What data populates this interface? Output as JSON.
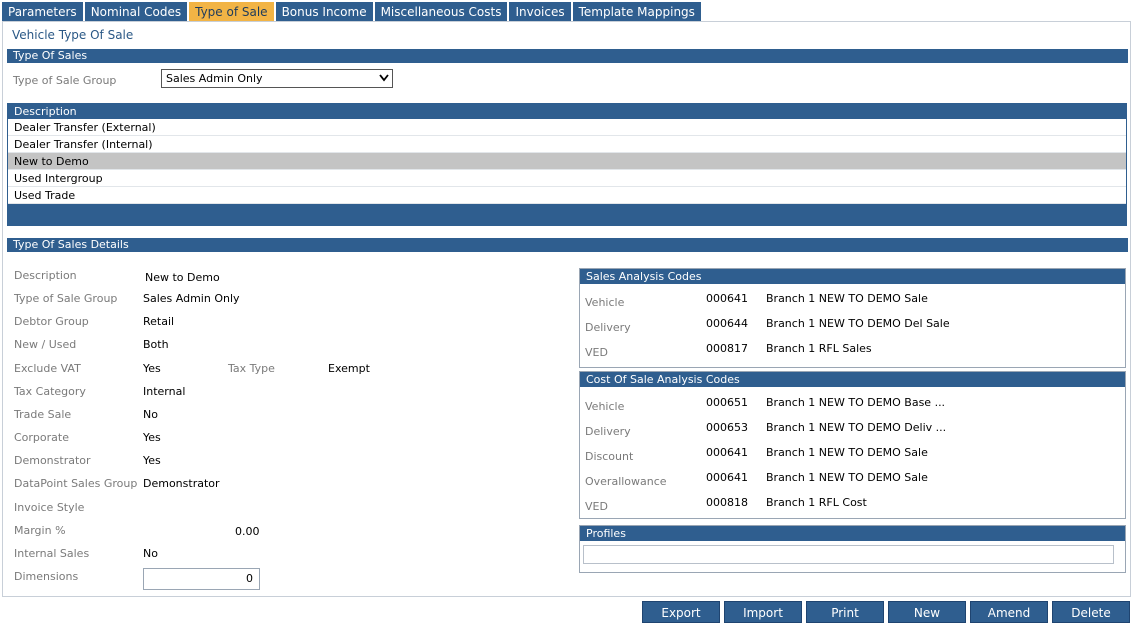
{
  "tabs": [
    "Parameters",
    "Nominal Codes",
    "Type of Sale",
    "Bonus Income",
    "Miscellaneous Costs",
    "Invoices",
    "Template Mappings"
  ],
  "active_tab": "Type of Sale",
  "page_title": "Vehicle Type Of Sale",
  "type_of_sales_header": "Type Of Sales",
  "group_label": "Type of Sale Group",
  "group_value": "Sales Admin Only",
  "list": {
    "header": "Description",
    "rows": [
      "Dealer Transfer (External)",
      "Dealer Transfer (Internal)",
      "New to Demo",
      "Used Intergroup",
      "Used Trade"
    ],
    "selected": "New to Demo"
  },
  "details_header": "Type Of Sales Details",
  "details": {
    "description": {
      "label": "Description",
      "value": "New to Demo"
    },
    "group": {
      "label": "Type of Sale Group",
      "value": "Sales Admin Only"
    },
    "debtor": {
      "label": "Debtor Group",
      "value": "Retail"
    },
    "new_used": {
      "label": "New / Used",
      "value": "Both"
    },
    "exclude_vat": {
      "label": "Exclude VAT",
      "value": "Yes"
    },
    "tax_type": {
      "label": "Tax Type",
      "value": "Exempt"
    },
    "tax_category": {
      "label": "Tax Category",
      "value": "Internal"
    },
    "trade_sale": {
      "label": "Trade Sale",
      "value": "No"
    },
    "corporate": {
      "label": "Corporate",
      "value": "Yes"
    },
    "demonstrator": {
      "label": "Demonstrator",
      "value": "Yes"
    },
    "datapoint": {
      "label": "DataPoint Sales Group",
      "value": "Demonstrator"
    },
    "invoice_style": {
      "label": "Invoice Style",
      "value": ""
    },
    "margin": {
      "label": "Margin %",
      "value": "0.00"
    },
    "internal_sales": {
      "label": "Internal Sales",
      "value": "No"
    },
    "dimensions": {
      "label": "Dimensions",
      "value": "0"
    }
  },
  "sales_analysis": {
    "header": "Sales Analysis Codes",
    "rows": [
      {
        "label": "Vehicle",
        "code": "000641",
        "desc": "Branch 1 NEW TO DEMO Sale"
      },
      {
        "label": "Delivery",
        "code": "000644",
        "desc": "Branch 1 NEW TO DEMO Del Sale"
      },
      {
        "label": "VED",
        "code": "000817",
        "desc": "Branch 1 RFL Sales"
      }
    ]
  },
  "cost_analysis": {
    "header": "Cost Of Sale Analysis Codes",
    "rows": [
      {
        "label": "Vehicle",
        "code": "000651",
        "desc": "Branch 1 NEW TO DEMO Base ..."
      },
      {
        "label": "Delivery",
        "code": "000653",
        "desc": "Branch 1 NEW TO DEMO Deliv ..."
      },
      {
        "label": "Discount",
        "code": "000641",
        "desc": "Branch 1 NEW TO DEMO Sale"
      },
      {
        "label": "Overallowance",
        "code": "000641",
        "desc": "Branch 1 NEW TO DEMO Sale"
      },
      {
        "label": "VED",
        "code": "000818",
        "desc": "Branch 1 RFL Cost"
      }
    ]
  },
  "profiles_header": "Profiles",
  "buttons": {
    "export": "Export",
    "import": "Import",
    "print": "Print",
    "new": "New",
    "amend": "Amend",
    "delete": "Delete"
  },
  "colors": {
    "header_blue": "#2f5e8f",
    "active_tab": "#f2b445",
    "selected_row": "#c4c4c4",
    "title_text": "#2a5886"
  }
}
